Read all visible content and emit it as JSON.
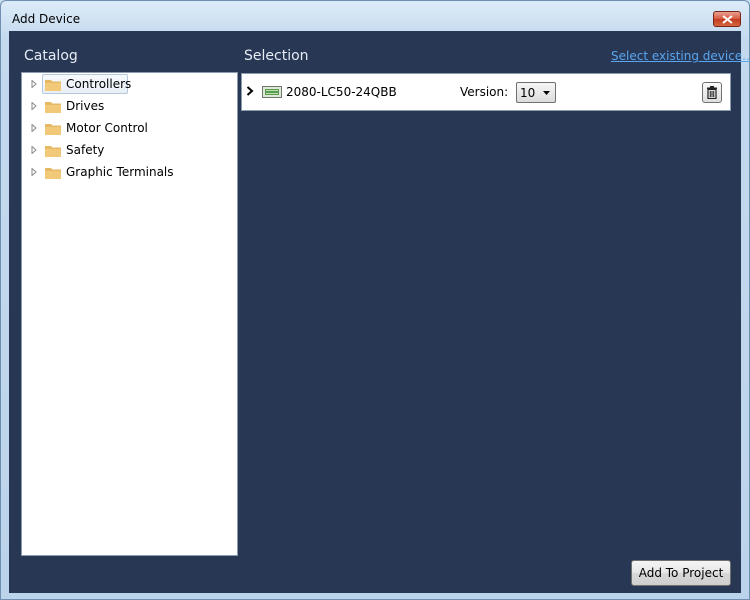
{
  "window": {
    "title": "Add Device"
  },
  "catalog": {
    "heading": "Catalog",
    "items": [
      {
        "label": "Controllers",
        "selected": true
      },
      {
        "label": "Drives"
      },
      {
        "label": "Motor Control"
      },
      {
        "label": "Safety"
      },
      {
        "label": "Graphic Terminals"
      }
    ]
  },
  "selection": {
    "heading": "Selection",
    "link_label": "Select existing device...",
    "device": {
      "name": "2080-LC50-24QBB",
      "version_label": "Version:",
      "version_value": "10"
    }
  },
  "footer": {
    "add_button_label": "Add To Project"
  },
  "colors": {
    "panel_bg": "#283753",
    "link": "#5aa6f0",
    "folder": "#e8b964"
  }
}
